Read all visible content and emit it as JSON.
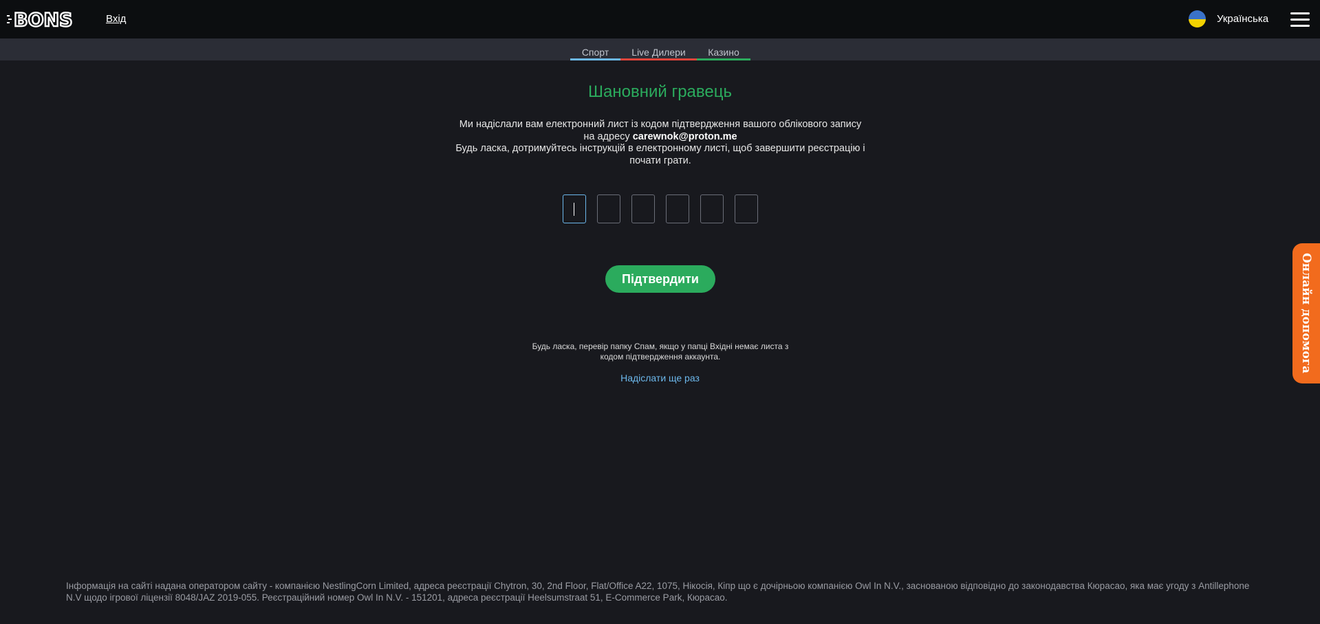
{
  "header": {
    "logo_text": "BONS",
    "login_label": "Вхід",
    "language_label": "Українська"
  },
  "tabs": [
    {
      "label": "Спорт",
      "color": "#6cb8ec"
    },
    {
      "label": "Live Дилери",
      "color": "#e0453b"
    },
    {
      "label": "Казино",
      "color": "#2bab5d"
    }
  ],
  "main": {
    "title": "Шановний гравець",
    "message_line1": "Ми надіслали вам електронний лист із кодом підтвердження вашого облікового запису на адресу",
    "email": "carewnok@proton.me",
    "message_line2": "Будь ласка, дотримуйтесь інструкцій в електронному листі, щоб завершити реєстрацію і почати грати.",
    "code_values": [
      "",
      "",
      "",
      "",
      "",
      ""
    ],
    "confirm_label": "Підтвердити",
    "spam_note": "Будь ласка, перевір папку Спам, якщо у папці Вхідні немає листа з кодом підтвердження аккаунта.",
    "resend_label": "Надіслати ще раз"
  },
  "support": {
    "label": "Онлайн допомога"
  },
  "footer": {
    "text": "Інформація на сайті надана оператором сайту - компанією NestlingCorn Limited, адреса реєстрації Chytron, 30, 2nd Floor, Flat/Office A22, 1075, Нікосія, Кіпр що є дочірньою компанією Owl In N.V., заснованою відповідно до законодавства Кюрасао, яка має угоду з Antillephone N.V щодо ігрової ліцензії 8048/JAZ 2019-055. Реєстраційний номер Owl In N.V. - 151201, адреса реєстрації Heelsumstraat 51, E-Commerce Park, Кюрасао."
  },
  "colors": {
    "accent_green": "#2bab5d",
    "link_blue": "#6cb8ec",
    "support_orange": "#f26b1d"
  }
}
